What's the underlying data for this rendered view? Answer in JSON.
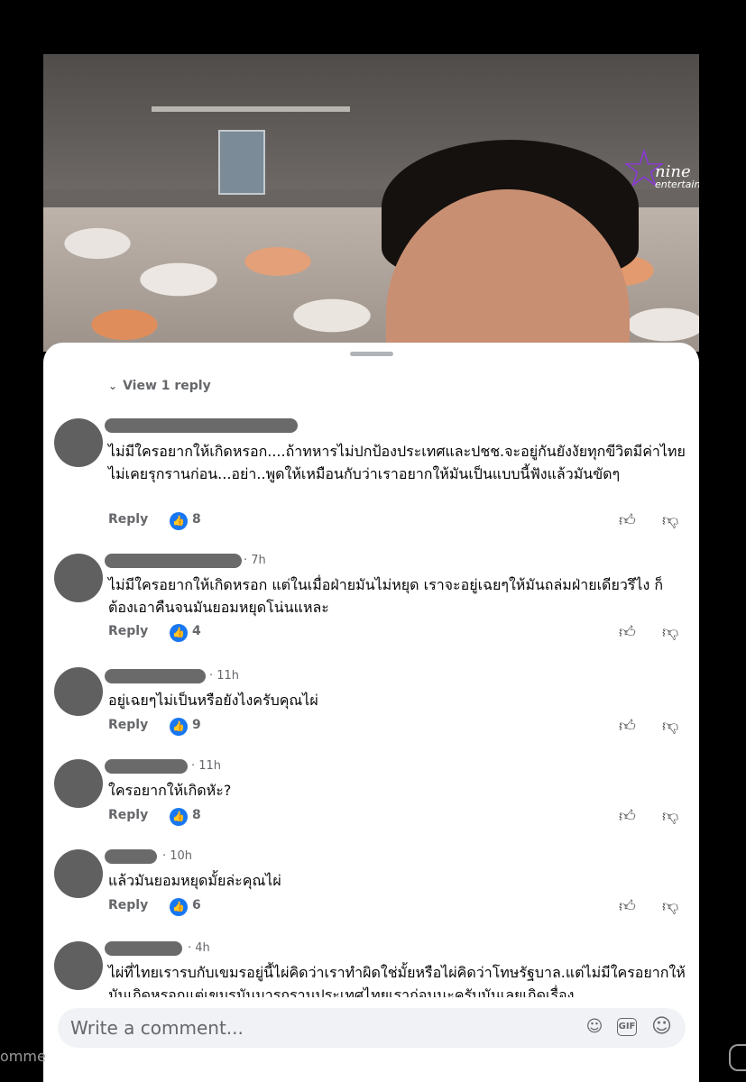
{
  "video": {
    "logo_line1": "nine",
    "logo_line2": "entertain"
  },
  "view_reply": "View 1 reply",
  "comments": [
    {
      "time": "",
      "text": "ไม่มีใครอยากให้เกิดหรอก....ถ้าทหารไม่ปกป้องประเทศและปชช.จะอยู่กันยังงัยทุกขีวิตมีค่าไทยไม่เคยรุกรานก่อน...อย่า..พูดให้เหมือนกับว่าเราอยากให้มันเป็นแบบนี้ฟังแล้วมันขัดๆ",
      "reply": "Reply",
      "likes": "8"
    },
    {
      "time": "· 7h",
      "text": "ไม่มีใครอยากให้เกิดหรอก แต่ในเมื่อฝ่ายมันไม่หยุด เราจะอยู่เฉยๆให้มันถล่มฝ่ายเดียวรึไง ก็ต้องเอาคืนจนมันยอมหยุดโน่นแหละ",
      "reply": "Reply",
      "likes": "4"
    },
    {
      "time": "· 11h",
      "text": "อยู่เฉยๆไม่เป็นหรือยังไงครับคุณไผ่",
      "reply": "Reply",
      "likes": "9"
    },
    {
      "time": "· 11h",
      "text": "ใครอยากให้เกิดหัะ?",
      "reply": "Reply",
      "likes": "8"
    },
    {
      "time": "· 10h",
      "text": "แล้วมันยอมหยุดมั้ยล่ะคุณไผ่",
      "reply": "Reply",
      "likes": "6"
    },
    {
      "time": "· 4h",
      "text": "ไผ่ที่ไทยเรารบกับเขมรอยู่นี้ไผ่คิดว่าเราทำผิดใช่มั้ยหรือไผ่คิดว่าโทษรัฐบาล.แต่ไม่มีใครอยากให้มันเกิดหรอกแต่เขมรมันมารุกรานประเทศไทยเราก่อนนะครับมันเลยเกิดเรื่อง"
    }
  ],
  "compose": {
    "placeholder": "Write a comment...",
    "gif_label": "GIF"
  },
  "under_left": "omme",
  "icons": [
    "chevron-down-icon",
    "like-icon",
    "thumb-up-icon",
    "thumb-down-icon",
    "sticker-icon",
    "gif-icon",
    "emoji-icon"
  ],
  "colors": {
    "accent": "#1877f2",
    "muted": "#65676b"
  }
}
